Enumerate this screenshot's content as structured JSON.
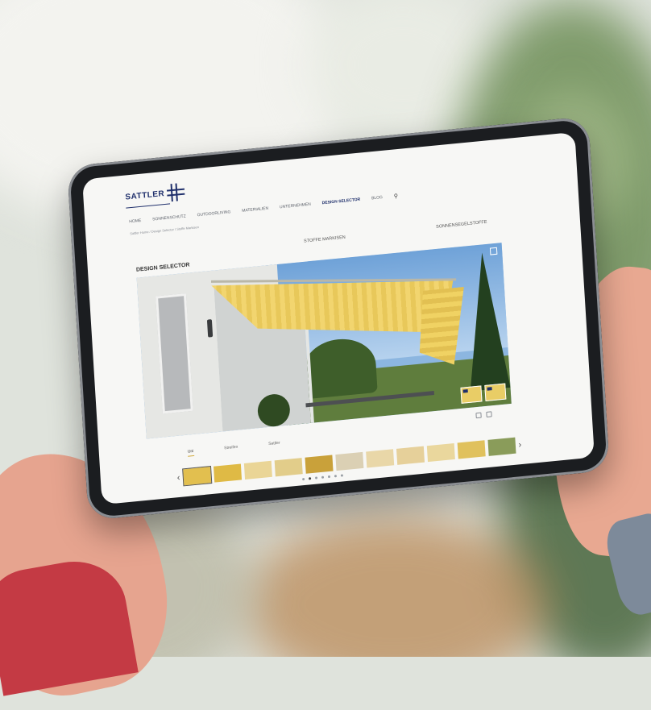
{
  "tablet": {
    "brand": "SATTLER",
    "nav": [
      {
        "label": "HOME"
      },
      {
        "label": "SONNENSCHUTZ",
        "has_dropdown": true
      },
      {
        "label": "OUTDOORLIVING",
        "has_dropdown": true
      },
      {
        "label": "MATERIALIEN",
        "has_dropdown": true
      },
      {
        "label": "UNTERNEHMEN",
        "has_dropdown": true
      },
      {
        "label": "DESIGN SELECTOR",
        "has_dropdown": true,
        "active": true
      },
      {
        "label": "BLOG"
      }
    ],
    "search_icon": "search-icon",
    "breadcrumb": "Sattler Home / Design Selector / Stoffe Markisen",
    "page_title": "DESIGN SELECTOR",
    "mode_tabs": [
      "STOFFE MARKISEN",
      "SONNENSEGELSTOFFE"
    ],
    "preview_icons": [
      "fullscreen-icon"
    ],
    "preview_thumbnails": 2,
    "fabric_tabs": [
      {
        "label": "Uni",
        "active": true
      },
      {
        "label": "Streifen"
      },
      {
        "label": "Sattler"
      }
    ],
    "fabric_colors": [
      "#e2bf4f",
      "#dfba45",
      "#ead596",
      "#e2cd8a",
      "#c9a13a",
      "#dbd0b4",
      "#e9d7a8",
      "#e6d09a",
      "#ead79d",
      "#e0c15d",
      "#8a9c5a"
    ],
    "colors": {
      "accent": "#d2a93a",
      "brand": "#1f2f6b",
      "awning": "#f0d263"
    }
  }
}
